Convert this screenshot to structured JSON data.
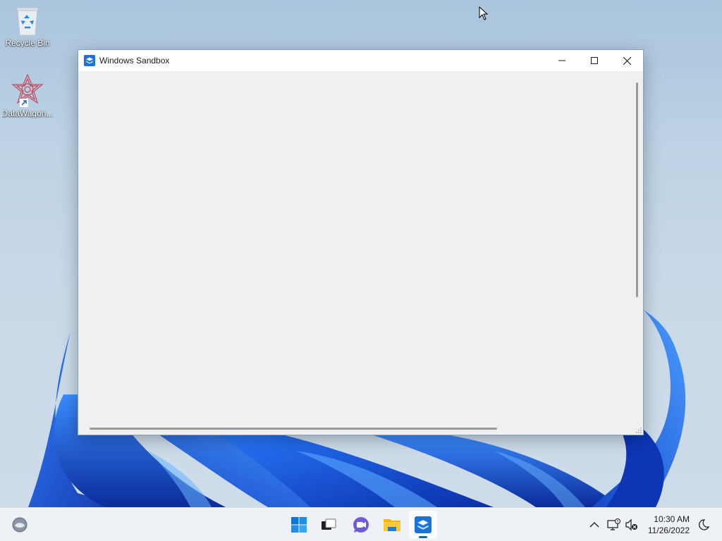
{
  "desktop": {
    "icons": [
      {
        "label": "Recycle Bin",
        "icon": "recycle-bin-icon"
      },
      {
        "label": "DataWagon...",
        "icon": "datawagon-shortcut-icon"
      }
    ]
  },
  "window": {
    "title": "Windows Sandbox",
    "icon": "windows-sandbox-icon",
    "controls": [
      "minimize-icon",
      "maximize-icon",
      "close-icon"
    ]
  },
  "taskbar": {
    "widgets_icon": "widgets-icon",
    "apps": [
      {
        "name": "start",
        "icon": "windows-start-icon"
      },
      {
        "name": "task-view",
        "icon": "task-view-icon"
      },
      {
        "name": "chat",
        "icon": "teams-chat-icon"
      },
      {
        "name": "file-explorer",
        "icon": "folder-icon"
      },
      {
        "name": "windows-sandbox",
        "icon": "windows-sandbox-icon",
        "active": true
      }
    ],
    "tray": {
      "icons": [
        "chevron-up-icon",
        "network-disconnected-icon",
        "sound-muted-icon",
        "focus-assist-icon"
      ],
      "time": "10:30 AM",
      "date": "11/26/2022"
    }
  },
  "colors": {
    "accent": "#0067c0",
    "wallpaper_blue": "#1a56d6",
    "window_bg": "#f0f0f0"
  }
}
